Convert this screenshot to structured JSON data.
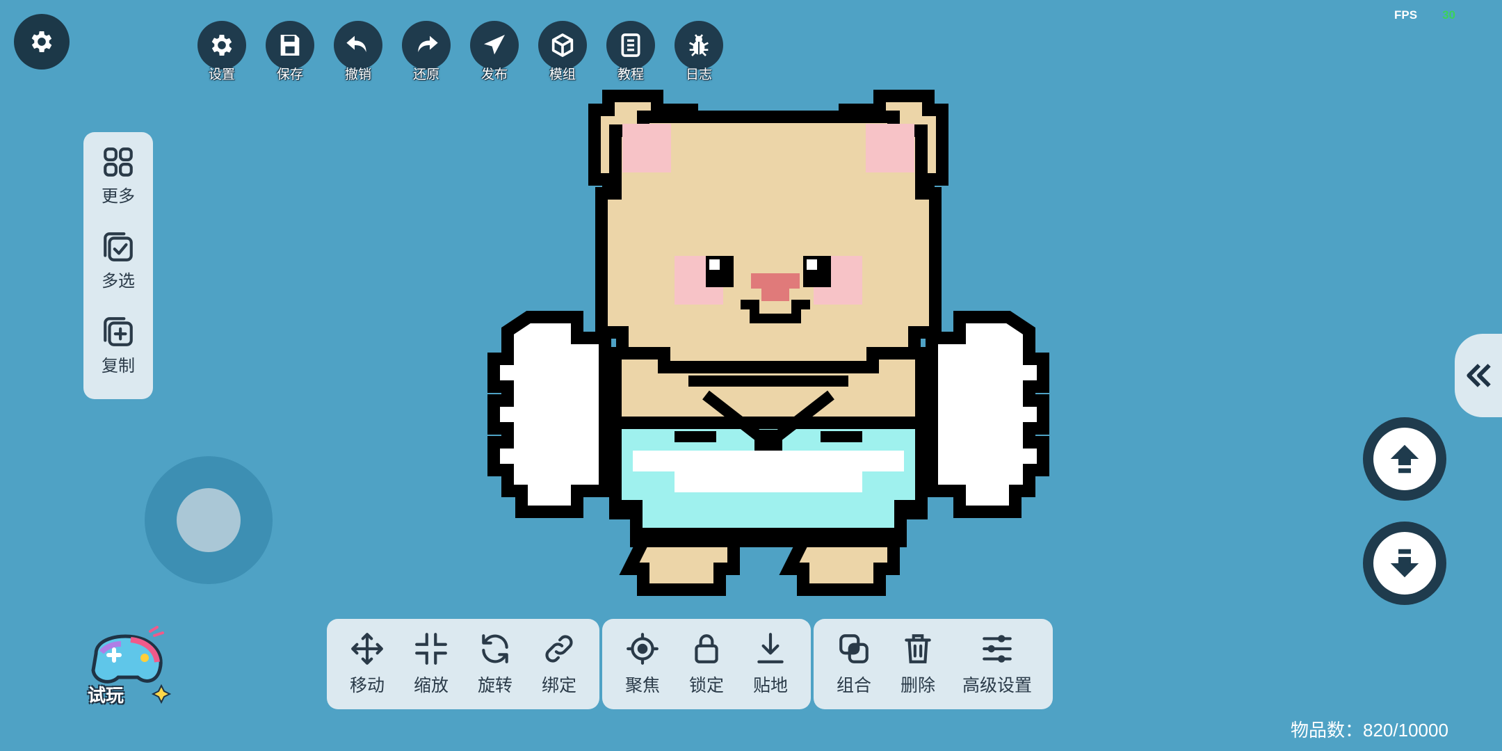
{
  "fps": {
    "label": "FPS",
    "value": "30"
  },
  "top_toolbar": [
    {
      "name": "settings",
      "label": "设置",
      "icon": "gear-icon"
    },
    {
      "name": "save",
      "label": "保存",
      "icon": "save-icon"
    },
    {
      "name": "undo",
      "label": "撤销",
      "icon": "undo-icon"
    },
    {
      "name": "redo",
      "label": "还原",
      "icon": "redo-icon"
    },
    {
      "name": "publish",
      "label": "发布",
      "icon": "paper-plane-icon"
    },
    {
      "name": "module",
      "label": "模组",
      "icon": "cube-icon"
    },
    {
      "name": "tutorial",
      "label": "教程",
      "icon": "book-icon"
    },
    {
      "name": "log",
      "label": "日志",
      "icon": "bug-icon"
    }
  ],
  "side_panel": [
    {
      "label": "更多",
      "icon": "grid-icon"
    },
    {
      "label": "多选",
      "icon": "multi-select-icon"
    },
    {
      "label": "复制",
      "icon": "copy-add-icon"
    }
  ],
  "try_play": {
    "label": "试玩"
  },
  "bottom_toolbar": {
    "transform": [
      {
        "label": "移动",
        "icon": "move-icon"
      },
      {
        "label": "缩放",
        "icon": "scale-icon"
      },
      {
        "label": "旋转",
        "icon": "rotate-icon"
      },
      {
        "label": "绑定",
        "icon": "link-icon"
      }
    ],
    "position": [
      {
        "label": "聚焦",
        "icon": "focus-icon"
      },
      {
        "label": "锁定",
        "icon": "lock-icon"
      },
      {
        "label": "贴地",
        "icon": "snap-ground-icon"
      }
    ],
    "edit": [
      {
        "label": "组合",
        "icon": "group-icon"
      },
      {
        "label": "删除",
        "icon": "trash-icon"
      },
      {
        "label": "高级设置",
        "icon": "sliders-icon"
      }
    ]
  },
  "item_count": "物品数：820/10000",
  "colors": {
    "background": "#4fa2c5",
    "dark": "#1f3b4d",
    "panel": "#dce9f0",
    "bear": "#ecd5a8",
    "blush": "#f7c3c7",
    "nose": "#e07a7a",
    "skirt": "#9ff1ee",
    "wing": "#ffffff"
  }
}
